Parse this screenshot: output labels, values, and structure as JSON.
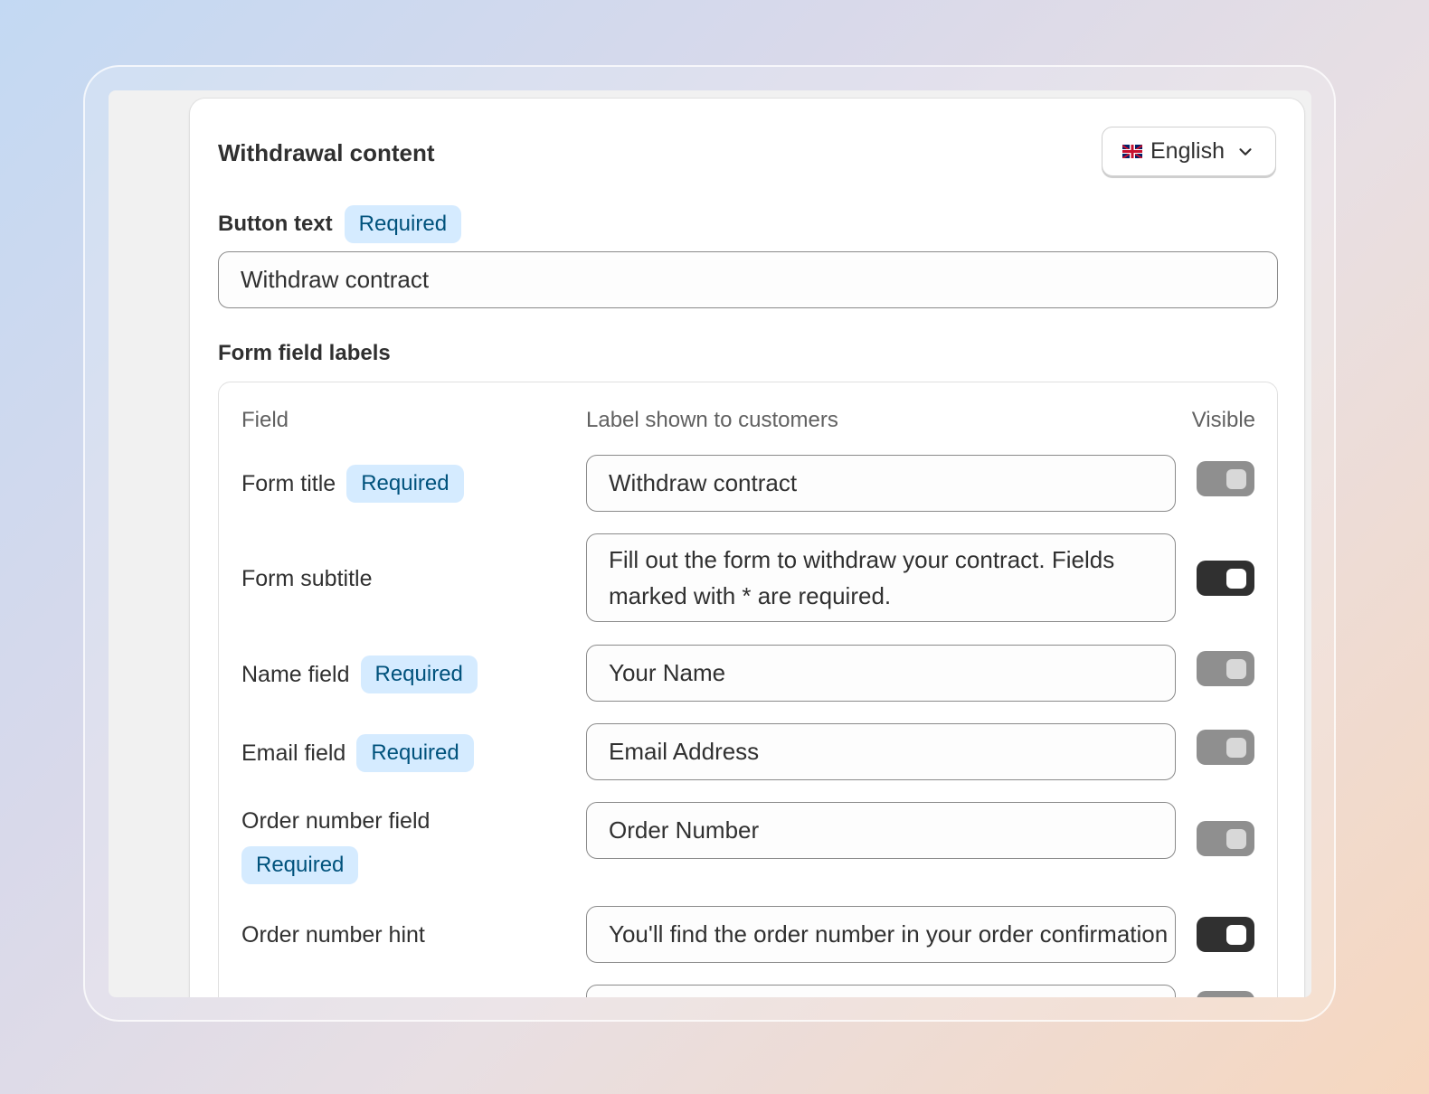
{
  "card": {
    "title": "Withdrawal content",
    "language": {
      "flag_icon": "uk-flag-icon",
      "label": "English",
      "chevron_icon": "chevron-down-icon"
    }
  },
  "button_text": {
    "label": "Button text",
    "badge": "Required",
    "value": "Withdraw contract"
  },
  "form_fields": {
    "section_title": "Form field labels",
    "columns": {
      "field": "Field",
      "label": "Label shown to customers",
      "visible": "Visible"
    },
    "rows": [
      {
        "name": "Form title",
        "badge": "Required",
        "value": "Withdraw contract",
        "visible": false
      },
      {
        "name": "Form subtitle",
        "badge": "",
        "value": "Fill out the form to withdraw your contract. Fields marked with * are required.",
        "visible": true
      },
      {
        "name": "Name field",
        "badge": "Required",
        "value": "Your Name",
        "visible": false
      },
      {
        "name": "Email field",
        "badge": "Required",
        "value": "Email Address",
        "visible": false
      },
      {
        "name": "Order number field",
        "badge": "Required",
        "value": "Order Number",
        "visible": false
      },
      {
        "name": "Order number hint",
        "badge": "",
        "value": "You'll find the order number in your order confirmation",
        "visible": true
      }
    ]
  },
  "colors": {
    "badge_bg": "#d5ebff",
    "badge_text": "#00527c",
    "toggle_on": "#303030",
    "toggle_off": "#8f8f8f"
  }
}
